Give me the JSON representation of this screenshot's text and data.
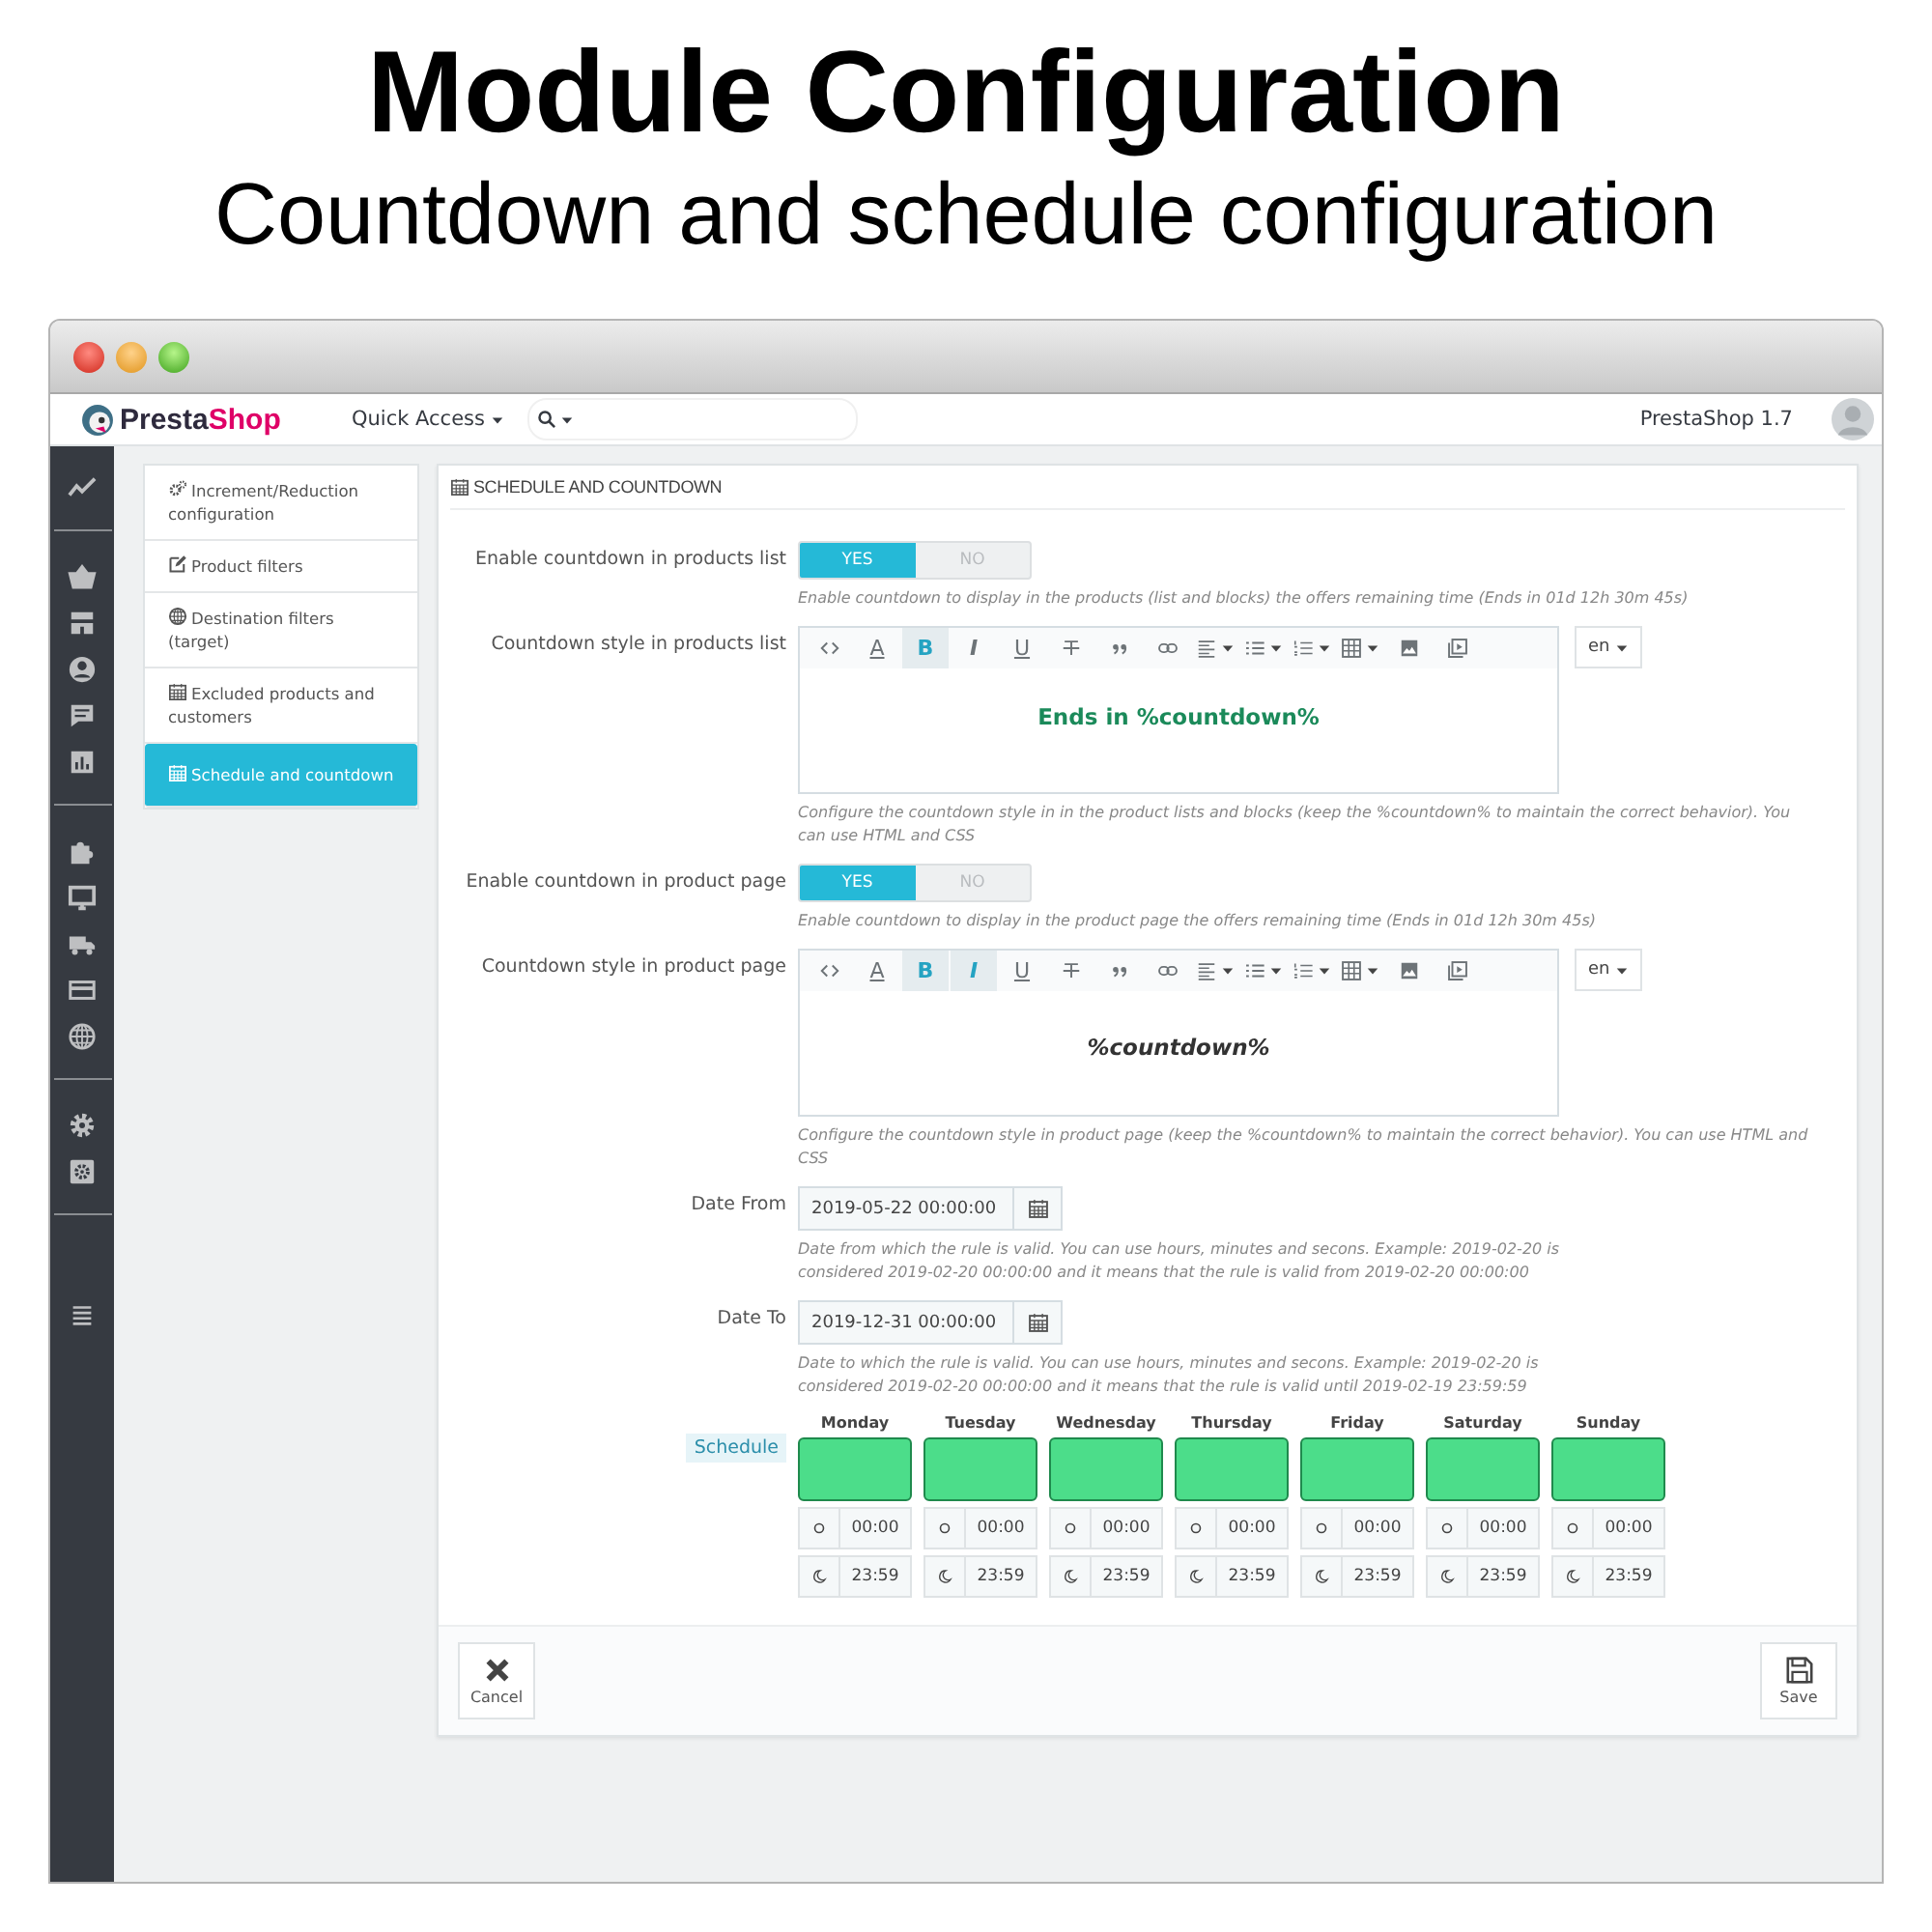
{
  "heading": {
    "title": "Module Configuration",
    "subtitle": "Countdown and schedule configuration"
  },
  "header": {
    "logo": [
      "Presta",
      "Shop"
    ],
    "quick_access": "Quick Access",
    "version": "PrestaShop 1.7"
  },
  "submenu": [
    {
      "label": "Increment/Reduction configuration",
      "selected": false
    },
    {
      "label": "Product filters",
      "selected": false
    },
    {
      "label": "Destination filters (target)",
      "selected": false
    },
    {
      "label": "Excluded products and customers",
      "selected": false
    },
    {
      "label": "Schedule and countdown",
      "selected": true
    }
  ],
  "panel": {
    "title": "SCHEDULE AND COUNTDOWN",
    "fields": [
      {
        "kind": "toggle",
        "label": "Enable countdown in products list",
        "on": true,
        "yes": "YES",
        "no": "NO",
        "help": "Enable countdown to display in the products (list and blocks) the offers remaining time (Ends in 01d 12h 30m 45s)"
      },
      {
        "kind": "editor",
        "label": "Countdown style in products list",
        "lang": "en",
        "content": "Ends in %countdown%",
        "help": "Configure the countdown style in in the product lists and blocks (keep the %countdown% to maintain the correct behavior). You can use HTML and CSS",
        "toolbar": [
          {
            "kind": "code",
            "active": false
          },
          {
            "kind": "text-color",
            "glyph": "A",
            "active": false
          },
          {
            "kind": "bold",
            "glyph": "B",
            "active": true
          },
          {
            "kind": "italic",
            "glyph": "I",
            "active": false
          },
          {
            "kind": "underline",
            "glyph": "U",
            "active": false
          },
          {
            "kind": "strike",
            "active": false
          },
          {
            "kind": "quote",
            "active": false
          },
          {
            "kind": "link",
            "active": false
          },
          {
            "kind": "align",
            "active": false
          },
          {
            "kind": "bullets",
            "active": false
          },
          {
            "kind": "numbers",
            "active": false
          },
          {
            "kind": "table",
            "active": false
          },
          {
            "kind": "image",
            "active": false
          },
          {
            "kind": "video",
            "active": false
          }
        ]
      },
      {
        "kind": "toggle",
        "label": "Enable countdown in product page",
        "on": true,
        "yes": "YES",
        "no": "NO",
        "help": "Enable countdown to display in the product page the offers remaining time (Ends in 01d 12h 30m 45s)"
      },
      {
        "kind": "editor",
        "label": "Countdown style in product page",
        "lang": "en",
        "content": "%countdown%",
        "help": "Configure the countdown style in product page (keep the %countdown% to maintain the correct behavior). You can use HTML and CSS",
        "toolbar": [
          {
            "kind": "code",
            "active": false
          },
          {
            "kind": "text-color",
            "glyph": "A",
            "active": false
          },
          {
            "kind": "bold",
            "glyph": "B",
            "active": true
          },
          {
            "kind": "italic",
            "glyph": "I",
            "active": true
          },
          {
            "kind": "underline",
            "glyph": "U",
            "active": false
          },
          {
            "kind": "strike",
            "active": false
          },
          {
            "kind": "quote",
            "active": false
          },
          {
            "kind": "link",
            "active": false
          },
          {
            "kind": "align",
            "active": false
          },
          {
            "kind": "bullets",
            "active": false
          },
          {
            "kind": "numbers",
            "active": false
          },
          {
            "kind": "table",
            "active": false
          },
          {
            "kind": "image",
            "active": false
          },
          {
            "kind": "video",
            "active": false
          }
        ]
      },
      {
        "kind": "date",
        "label": "Date From",
        "value": "2019-05-22 00:00:00",
        "help": "Date from which the rule is valid. You can use hours, minutes and secons. Example: 2019-02-20 is considered 2019-02-20 00:00:00 and it means that the rule is valid from 2019-02-20 00:00:00"
      },
      {
        "kind": "date",
        "label": "Date To",
        "value": "2019-12-31 00:00:00",
        "help": "Date to which the rule is valid. You can use hours, minutes and secons. Example: 2019-02-20 is considered 2019-02-20 00:00:00 and it means that the rule is valid until 2019-02-19 23:59:59"
      },
      {
        "kind": "schedule",
        "label": "Schedule",
        "days": [
          {
            "name": "Monday",
            "enabled": true,
            "start": "00:00",
            "end": "23:59"
          },
          {
            "name": "Tuesday",
            "enabled": true,
            "start": "00:00",
            "end": "23:59"
          },
          {
            "name": "Wednesday",
            "enabled": true,
            "start": "00:00",
            "end": "23:59"
          },
          {
            "name": "Thursday",
            "enabled": true,
            "start": "00:00",
            "end": "23:59"
          },
          {
            "name": "Friday",
            "enabled": true,
            "start": "00:00",
            "end": "23:59"
          },
          {
            "name": "Saturday",
            "enabled": true,
            "start": "00:00",
            "end": "23:59"
          },
          {
            "name": "Sunday",
            "enabled": true,
            "start": "00:00",
            "end": "23:59"
          }
        ]
      }
    ],
    "cancel": "Cancel",
    "save": "Save"
  }
}
